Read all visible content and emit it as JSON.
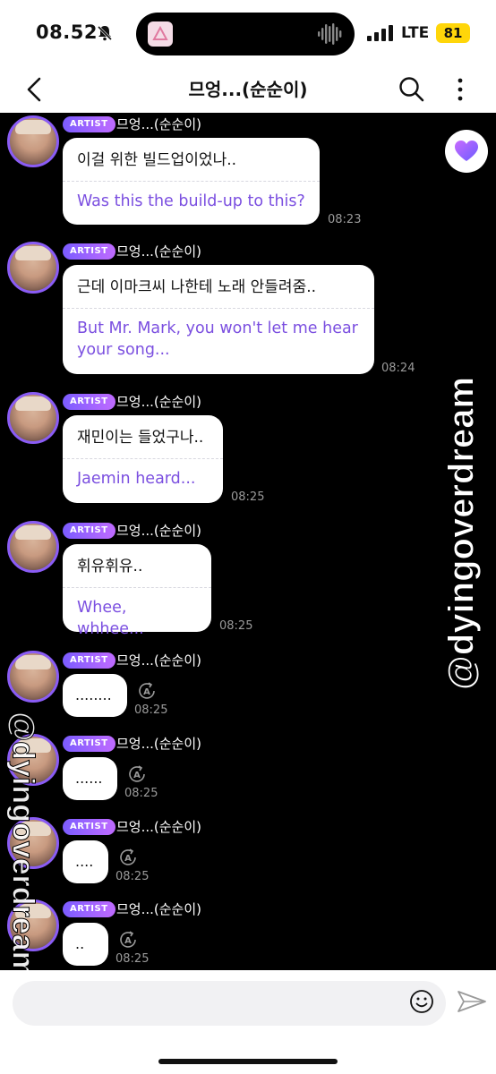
{
  "status_bar": {
    "time": "08.52",
    "network": "LTE",
    "battery": "81"
  },
  "header": {
    "title": "므엉...(순순이)"
  },
  "messages": [
    {
      "badge": "ARTIST",
      "sender": "므엉...(순순이)",
      "text": "이걸 위한 빌드업이었나..",
      "translation": "Was this the build-up to this?",
      "time": "08:23"
    },
    {
      "badge": "ARTIST",
      "sender": "므엉...(순순이)",
      "text": "근데 이마크씨 나한테 노래 안들려줌..",
      "translation": "But Mr. Mark, you won't let me hear your song...",
      "time": "08:24"
    },
    {
      "badge": "ARTIST",
      "sender": "므엉...(순순이)",
      "text": "재민이는 들었구나..",
      "translation": "Jaemin heard...",
      "time": "08:25"
    },
    {
      "badge": "ARTIST",
      "sender": "므엉...(순순이)",
      "text": "휘유휘유..",
      "translation": "Whee, whhee...",
      "time": "08:25"
    },
    {
      "badge": "ARTIST",
      "sender": "므엉...(순순이)",
      "text": "........",
      "time": "08:25"
    },
    {
      "badge": "ARTIST",
      "sender": "므엉...(순순이)",
      "text": "......",
      "time": "08:25"
    },
    {
      "badge": "ARTIST",
      "sender": "므엉...(순순이)",
      "text": "....",
      "time": "08:25"
    },
    {
      "badge": "ARTIST",
      "sender": "므엉...(순순이)",
      "text": "..",
      "time": "08:25"
    }
  ],
  "watermarks": {
    "right": "@dyingoverdream",
    "left": "@dyingoverdream"
  },
  "colors": {
    "accent": "#7b4fe0",
    "badge_start": "#7b5cff",
    "badge_end": "#c06bff",
    "chat_bg": "#000000"
  }
}
